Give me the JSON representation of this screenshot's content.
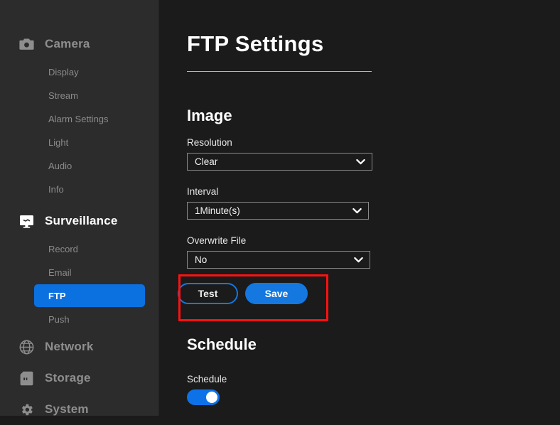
{
  "theme": {
    "accent": "#0d72e8",
    "accent_button": "#1478e0",
    "sidebar_bg": "#2c2c2c",
    "main_bg": "#1b1b1b",
    "annotation_color": "#ff1111",
    "muted_text": "#8b8b8b",
    "active_text": "#ffffff"
  },
  "sidebar": {
    "groups": [
      {
        "label": "Camera",
        "icon": "camera-icon",
        "active": false,
        "items": [
          {
            "label": "Display",
            "active": false
          },
          {
            "label": "Stream",
            "active": false
          },
          {
            "label": "Alarm Settings",
            "active": false
          },
          {
            "label": "Light",
            "active": false
          },
          {
            "label": "Audio",
            "active": false
          },
          {
            "label": "Info",
            "active": false
          }
        ]
      },
      {
        "label": "Surveillance",
        "icon": "monitor-icon",
        "active": true,
        "items": [
          {
            "label": "Record",
            "active": false
          },
          {
            "label": "Email",
            "active": false
          },
          {
            "label": "FTP",
            "active": true
          },
          {
            "label": "Push",
            "active": false
          }
        ]
      },
      {
        "label": "Network",
        "icon": "globe-icon",
        "active": false,
        "items": []
      },
      {
        "label": "Storage",
        "icon": "sdcard-icon",
        "active": false,
        "items": []
      },
      {
        "label": "System",
        "icon": "gear-icon",
        "active": false,
        "items": []
      }
    ]
  },
  "main": {
    "page_title": "FTP Settings",
    "sections": [
      {
        "title": "Image",
        "fields": [
          {
            "label": "Resolution",
            "value": "Clear",
            "control": "select",
            "icon": "chevron-down-icon"
          },
          {
            "label": "Interval",
            "value": "1Minute(s)",
            "control": "select",
            "icon": "chevron-down-icon"
          },
          {
            "label": "Overwrite File",
            "value": "No",
            "control": "select",
            "icon": "chevron-down-icon"
          }
        ],
        "buttons": {
          "test_label": "Test",
          "save_label": "Save"
        }
      },
      {
        "title": "Schedule",
        "fields": [
          {
            "label": "Schedule",
            "value": "on",
            "control": "toggle"
          }
        ]
      }
    ]
  }
}
